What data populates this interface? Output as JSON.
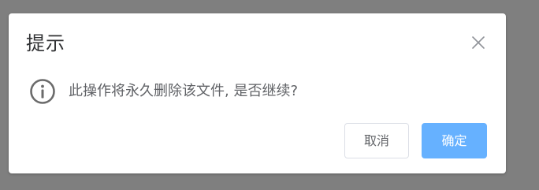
{
  "dialog": {
    "title": "提示",
    "message": "此操作将永久删除该文件, 是否继续?",
    "close_icon": "close-icon",
    "status_icon": "info-circle-icon",
    "cancel_label": "取消",
    "confirm_label": "确定"
  },
  "colors": {
    "overlay": "#7f7f7f",
    "dialog_bg": "#ffffff",
    "title_text": "#303133",
    "message_text": "#606266",
    "icon": "#6b6b6b",
    "confirm_bg": "#66b1ff",
    "cancel_border": "#dcdfe6"
  }
}
